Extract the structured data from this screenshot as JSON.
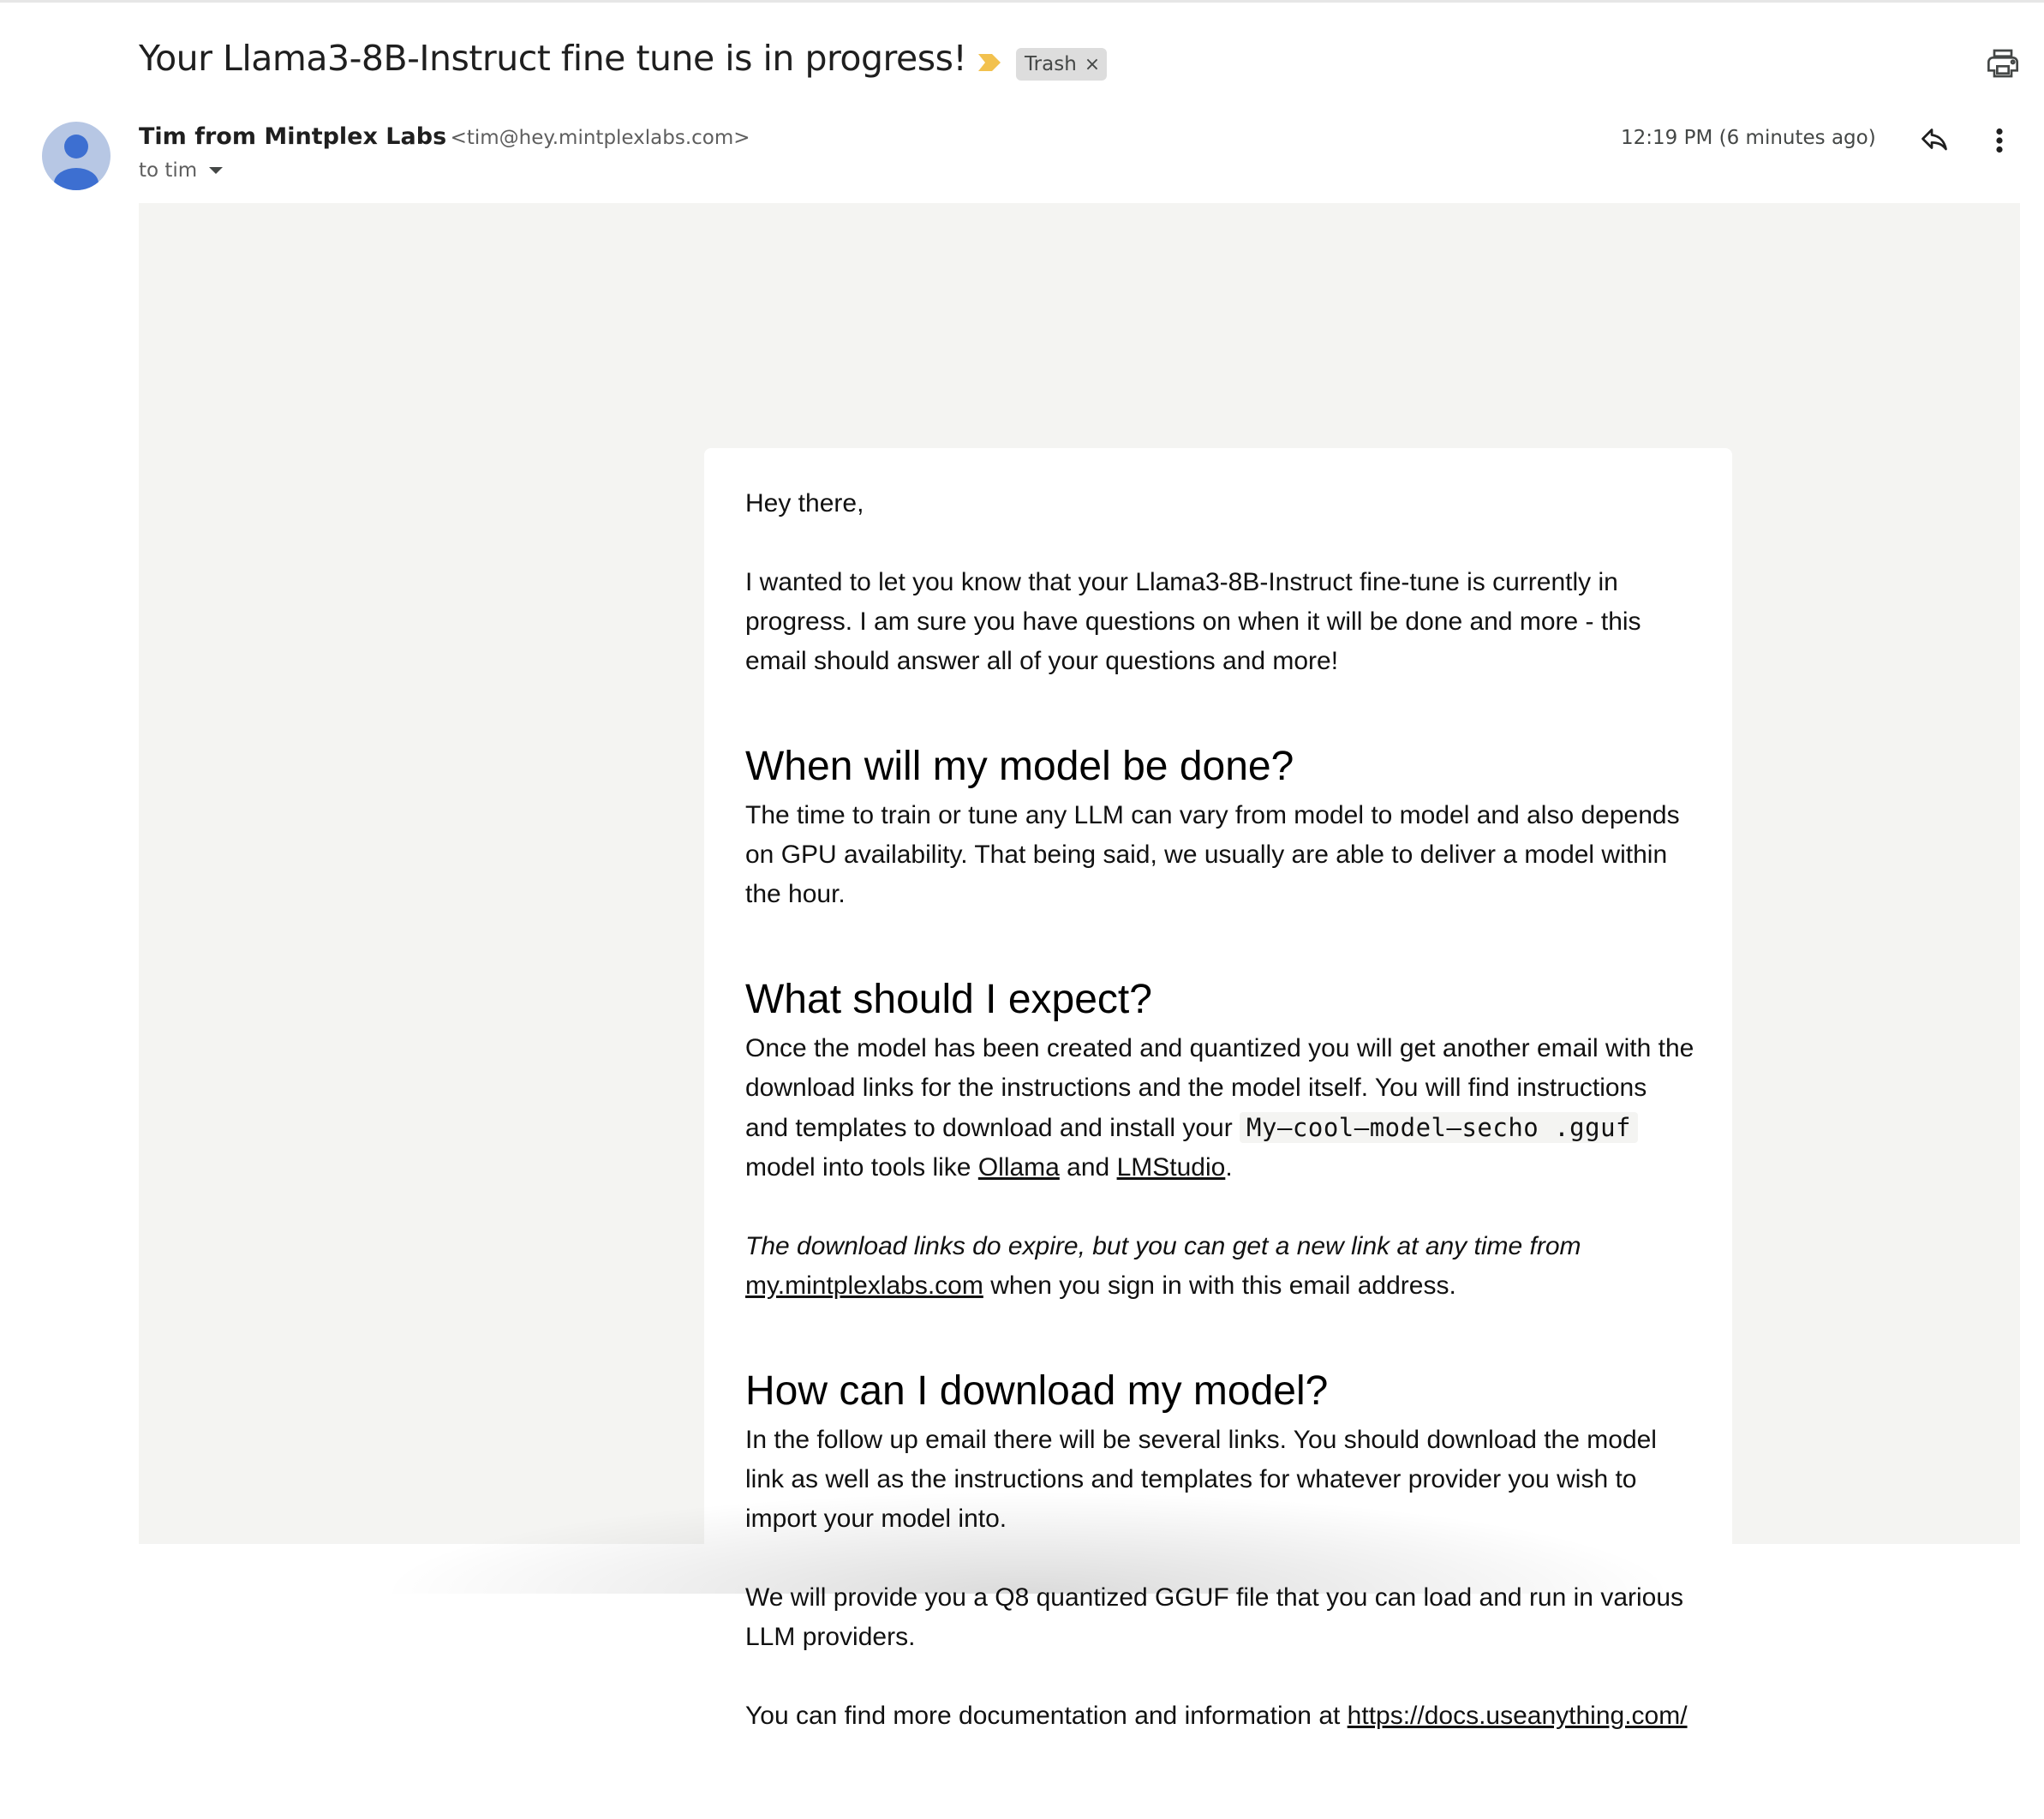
{
  "header": {
    "subject": "Your Llama3-8B-Instruct fine tune is in progress!",
    "label": "Trash",
    "label_remove_glyph": "×",
    "important_marker_icon": "importance-marker-icon",
    "print_icon": "print-icon"
  },
  "sender": {
    "name": "Tim from Mintplex Labs",
    "email": "<tim@hey.mintplexlabs.com>",
    "to": "to tim",
    "timestamp": "12:19 PM (6 minutes ago)",
    "avatar_icon": "default-avatar-icon",
    "reply_icon": "reply-icon",
    "more_icon": "more-vert-icon"
  },
  "body": {
    "greeting": "Hey there,",
    "intro": "I wanted to let you know that your Llama3-8B-Instruct fine-tune is currently in progress. I am sure you have questions on when it will be done and more - this email should answer all of your questions and more!",
    "h_done": "When will my model be done?",
    "p_done": "The time to train or tune any LLM can vary from model to model and also depends on GPU availability. That being said, we usually are able to deliver a model within the hour.",
    "h_expect": "What should I expect?",
    "p_expect_1": "Once the model has been created and quantized you will get another email with the download links for the instructions and the model itself. You will find instructions and templates to download and install your ",
    "p_expect_code": "My–cool–model–secho .gguf",
    "p_expect_2": " model into tools like ",
    "link_ollama": "Ollama",
    "p_expect_and": " and ",
    "link_lmstudio": "LMStudio",
    "p_expect_end": ".",
    "p_expire_italic": "The download links do expire, but you can get a new link at any time from",
    "link_my": "my.mintplexlabs.com",
    "p_expire_rest": " when you sign in with this email address.",
    "h_download": "How can I download my model?",
    "p_download_1": "In the follow up email there will be several links. You should download the model link as well as the instructions and templates for whatever provider you wish to import your model into.",
    "p_download_2": "We will provide you a Q8 quantized GGUF file that you can load and run in various LLM providers.",
    "p_docs": "You can find more documentation and information at ",
    "link_docs": "https://docs.useanything.com/"
  },
  "colors": {
    "important_marker": "#f2c14e",
    "email_background": "#f4f4f2",
    "label_chip": "#dddddd"
  }
}
